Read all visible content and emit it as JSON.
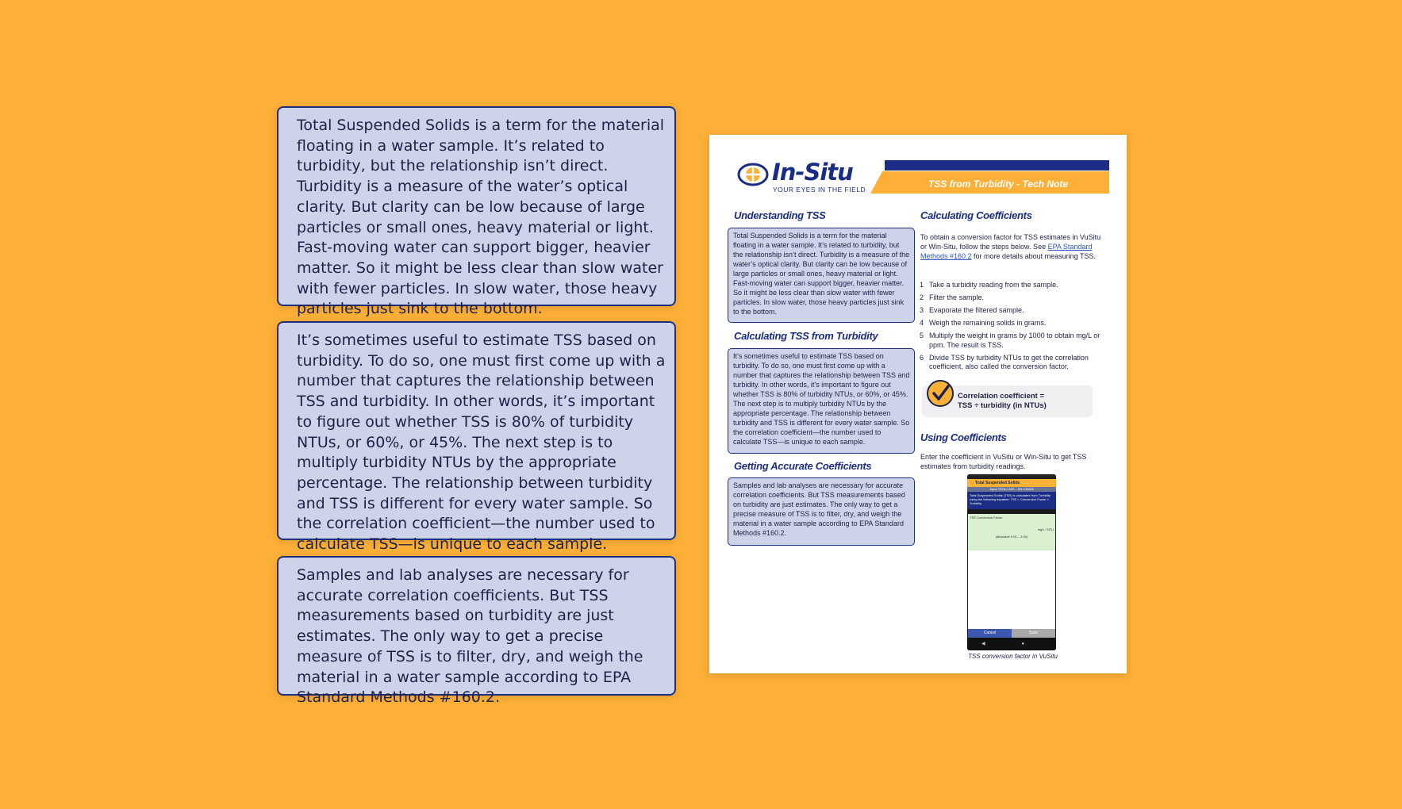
{
  "callouts": {
    "understanding": "Total Suspended Solids is a term for the material floating in a water sample. It’s related to turbidity, but the relationship isn’t direct. Turbidity is a measure of the water’s optical clarity. But clarity can be low because of large particles or small ones, heavy material or light. Fast-moving water can support bigger, heavier matter. So it might be less clear than slow water with fewer particles. In slow water, those heavy particles just sink to the bottom.",
    "calculating": "It’s sometimes useful to estimate TSS based on turbidity. To do so, one must first come up with a number that captures the relationship between TSS and turbidity. In other words, it’s important to figure out whether TSS is 80% of turbidity NTUs, or 60%, or 45%. The next step is to multiply turbidity NTUs by the appropriate percentage. The relationship between turbidity and TSS is different for every water sample. So the correlation coefficient—the number used to calculate TSS—is unique to each sample.",
    "accurate": "Samples and lab analyses are necessary for accurate correlation coefficients. But TSS measurements based on turbidity are just estimates. The only way to get a precise measure of TSS is to filter, dry, and weigh the material in a water sample according to EPA Standard Methods #160.2."
  },
  "sheet": {
    "brand": "In-Situ",
    "tagline": "YOUR EYES IN THE FIELD",
    "doc_title": "TSS from Turbidity - Tech Note",
    "headings": {
      "understanding": "Understanding TSS",
      "calculating": "Calculating TSS from Turbidity",
      "accurate": "Getting Accurate Coefficients",
      "coefficients": "Calculating Coefficients",
      "using": "Using Coefficients"
    },
    "coeff_intro_a": "To obtain a conversion factor for TSS estimates in VuSitu or Win-Situ, follow the steps below. See ",
    "coeff_intro_link": "EPA Standard Methods #160.2",
    "coeff_intro_b": " for more details about measuring TSS.",
    "steps": [
      {
        "n": "1",
        "text": "Take a turbidity reading from the sample."
      },
      {
        "n": "2",
        "text": "Filter the sample."
      },
      {
        "n": "3",
        "text": "Evaporate the filtered sample."
      },
      {
        "n": "4",
        "text": "Weigh the remaining solids in grams."
      },
      {
        "n": "5",
        "text": "Multiply the weight in grams by 1000 to obtain mg/L or ppm. The result is TSS."
      },
      {
        "n": "6",
        "text": "Divide TSS by turbidity NTUs to get the correlation coefficient, also called the conversion factor."
      }
    ],
    "corr_line1": "Correlation coefficient  =",
    "corr_line2": "TSS ÷ turbidity (in NTUs)",
    "using_text": "Enter the coefficient in VuSitu or Win-Situ to get TSS estimates from turbidity readings.",
    "phone": {
      "header": "Total Suspended Solids",
      "sub": "Aqua TROLL 600 – SN 123456",
      "blue_text": "Total Suspended Solids (TSS) is calculated from Turbidity using the following equation: TSS = Conversion Factor × Turbidity",
      "field_label": "TSS Conversion Factor",
      "field_value": "mg/L / NTU",
      "field_range": "(allowable 0.00 – 3.00)",
      "cancel": "Cancel",
      "save": "Save",
      "nav": "◀ ● ■"
    },
    "caption": "TSS conversion factor in VuSitu"
  },
  "colors": {
    "background": "#FDB038",
    "navy": "#1C2D86",
    "callout_fill": "#CDD3E9"
  }
}
